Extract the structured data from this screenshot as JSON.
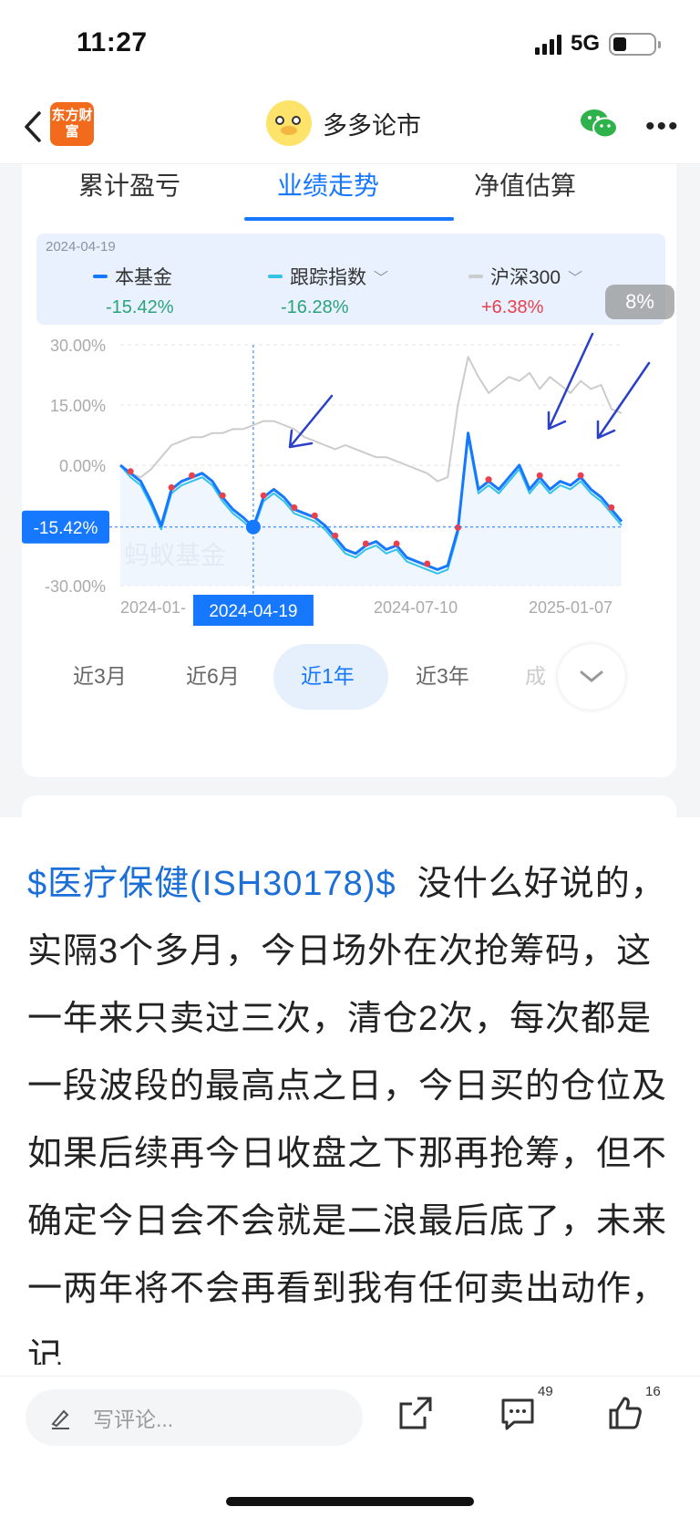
{
  "status": {
    "time": "11:27",
    "network": "5G"
  },
  "nav": {
    "logo_text": "东方财富",
    "title": "多多论市"
  },
  "tabs": [
    {
      "label": "累计盈亏",
      "active": false
    },
    {
      "label": "业绩走势",
      "active": true
    },
    {
      "label": "净值估算",
      "active": false
    }
  ],
  "legend": {
    "date": "2024-04-19",
    "items": [
      {
        "name": "本基金",
        "value": "-15.42%",
        "color": "#1677ff",
        "value_color": "#2aa37a"
      },
      {
        "name": "跟踪指数",
        "value": "-16.28%",
        "color": "#34c2e8",
        "value_color": "#2aa37a"
      },
      {
        "name": "沪深300",
        "value": "+6.38%",
        "color": "#cccccc",
        "value_color": "#e8414d"
      }
    ]
  },
  "pill": "8%",
  "chart_data": {
    "type": "line",
    "ylim": [
      -30,
      30
    ],
    "yticks": [
      "30.00%",
      "15.00%",
      "0.00%",
      "-15.00%",
      "-30.00%"
    ],
    "xticks": [
      "2024-01-",
      "2024-04-19",
      "2024-07-10",
      "2025-01-07"
    ],
    "watermark": "蚂蚁基金",
    "cursor": {
      "date": "2024-04-19",
      "label": "-15.42%"
    },
    "series": [
      {
        "name": "本基金",
        "color": "#1677ff",
        "values": [
          0,
          -2,
          -4,
          -9,
          -15,
          -6,
          -4,
          -3,
          -2,
          -4,
          -8,
          -11,
          -13,
          -15.4,
          -8,
          -6,
          -8,
          -11,
          -12,
          -13,
          -15,
          -18,
          -21,
          -22,
          -20,
          -19,
          -21,
          -20,
          -23,
          -24,
          -25,
          -26,
          -25,
          -16,
          8,
          -6,
          -4,
          -6,
          -3,
          0,
          -6,
          -3,
          -6,
          -4,
          -5,
          -3,
          -6,
          -8,
          -11,
          -14
        ]
      },
      {
        "name": "跟踪指数",
        "color": "#34c2e8",
        "values": [
          0,
          -3,
          -5,
          -10,
          -16,
          -7,
          -5,
          -4,
          -3,
          -5,
          -9,
          -12,
          -14,
          -16.3,
          -9,
          -7,
          -9,
          -12,
          -13,
          -14,
          -16,
          -19,
          -22,
          -23,
          -21,
          -20,
          -22,
          -21,
          -24,
          -25,
          -26,
          -27,
          -26,
          -17,
          7,
          -7,
          -5,
          -7,
          -4,
          -1,
          -7,
          -4,
          -7,
          -5,
          -6,
          -4,
          -7,
          -9,
          -12,
          -15
        ]
      },
      {
        "name": "沪深300",
        "color": "#cccccc",
        "values": [
          0,
          -2,
          -3,
          -1,
          2,
          5,
          6,
          7,
          7,
          8,
          8,
          9,
          9,
          10,
          11,
          11,
          10,
          9,
          7,
          6,
          5,
          4,
          5,
          4,
          3,
          2,
          2,
          1,
          0,
          -1,
          -2,
          -4,
          -3,
          15,
          27,
          22,
          18,
          20,
          22,
          21,
          23,
          19,
          22,
          20,
          18,
          21,
          19,
          20,
          14,
          13
        ]
      }
    ],
    "markers": [
      1,
      5,
      7,
      10,
      14,
      17,
      19,
      21,
      24,
      27,
      30,
      33,
      36,
      41,
      45,
      48
    ]
  },
  "ranges": [
    {
      "label": "近3月",
      "active": false
    },
    {
      "label": "近6月",
      "active": false
    },
    {
      "label": "近1年",
      "active": true
    },
    {
      "label": "近3年",
      "active": false
    },
    {
      "label": "成",
      "active": false
    }
  ],
  "post": {
    "link": "$医疗保健(ISH30178)$",
    "text": "没什么好说的，实隔3个多月，今日场外在次抢筹码，这一年来只卖过三次，清仓2次，每次都是一段波段的最高点之日，今日买的仓位及如果后续再今日收盘之下那再抢筹，但不确定今日会不会就是二浪最后底了，未来一两年将不会再看到我有任何卖出动作，记"
  },
  "bottom": {
    "comment_placeholder": "写评论...",
    "comment_count": "49",
    "like_count": "16"
  }
}
